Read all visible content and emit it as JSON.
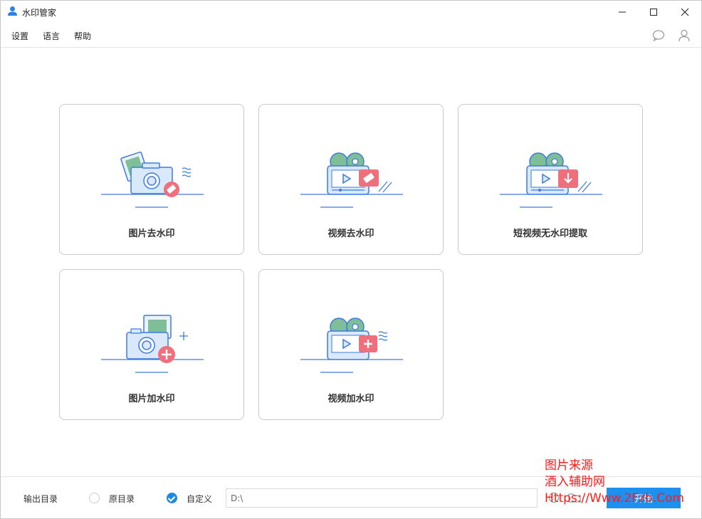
{
  "window": {
    "title": "水印管家"
  },
  "menu": {
    "items": [
      "设置",
      "语言",
      "帮助"
    ]
  },
  "cards": [
    {
      "label": "图片去水印",
      "icon": "image-remove-watermark-icon"
    },
    {
      "label": "视频去水印",
      "icon": "video-remove-watermark-icon"
    },
    {
      "label": "短视频无水印提取",
      "icon": "short-video-extract-icon"
    },
    {
      "label": "图片加水印",
      "icon": "image-add-watermark-icon"
    },
    {
      "label": "视频加水印",
      "icon": "video-add-watermark-icon"
    }
  ],
  "bottom": {
    "output_label": "输出目录",
    "option_original": "原目录",
    "option_custom": "自定义",
    "selected_option": "自定义",
    "path_value": "D:\\",
    "start_button": "开始"
  },
  "overlay": {
    "line1": "图片来源",
    "line2": "酒入辅助网",
    "line3": "Https://Www.2Fzb.Com"
  },
  "colors": {
    "accent": "#1e90f0",
    "overlay_text": "#ff1a1a",
    "illus_blue": "#3d7be0",
    "illus_red": "#ef6f7c",
    "illus_green": "#7fbf97"
  }
}
